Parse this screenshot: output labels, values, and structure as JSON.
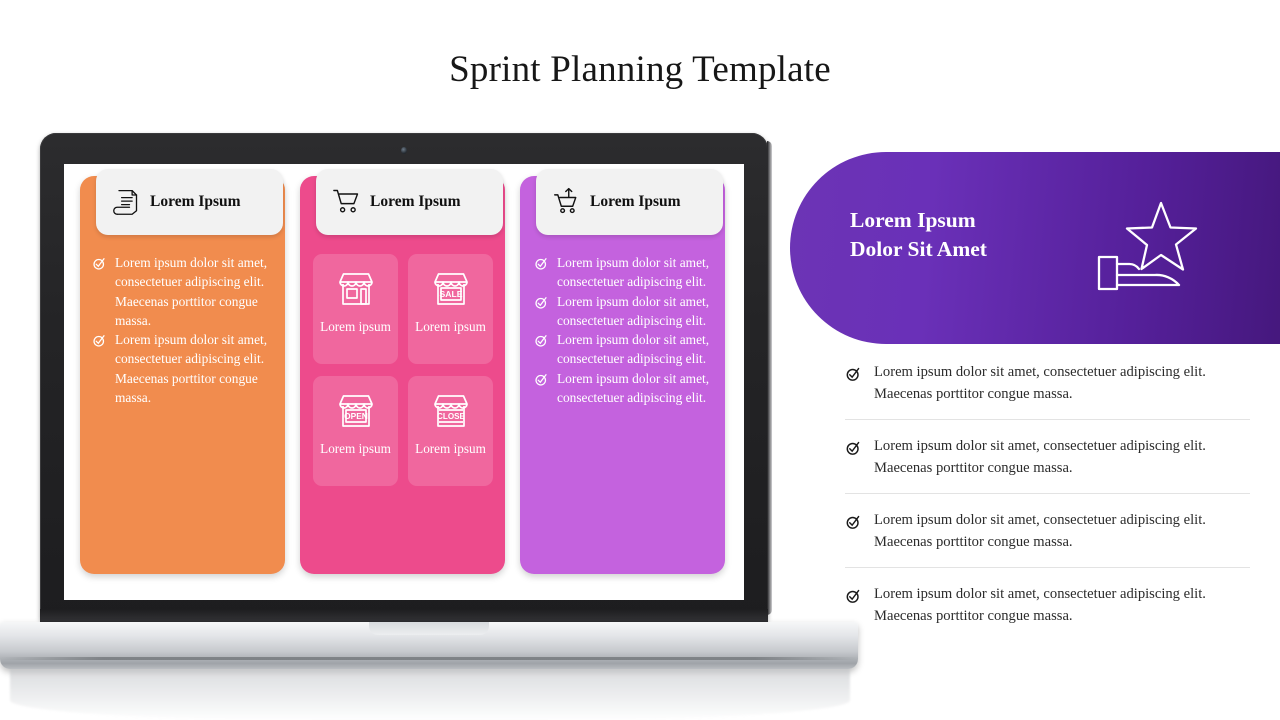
{
  "page": {
    "title": "Sprint Planning Template"
  },
  "laptop": {
    "device_name": "laptop-mockup",
    "camera": "webcam-dot"
  },
  "columns": [
    {
      "id": "orange",
      "color": "#F18C4E",
      "icon": "scroll-document-icon",
      "header": "Lorem Ipsum",
      "bullets": [
        "Lorem ipsum dolor sit amet, consectetuer adipiscing elit. Maecenas porttitor congue massa.",
        "Lorem ipsum dolor sit amet, consectetuer adipiscing elit. Maecenas porttitor congue massa."
      ]
    },
    {
      "id": "pink",
      "color": "#ED4B8C",
      "icon": "shopping-cart-icon",
      "header": "Lorem Ipsum",
      "tiles": [
        {
          "icon": "store-front-icon",
          "label": "Lorem ipsum"
        },
        {
          "icon": "store-sale-icon",
          "label": "Lorem ipsum"
        },
        {
          "icon": "store-open-icon",
          "label": "Lorem ipsum"
        },
        {
          "icon": "store-close-icon",
          "label": "Lorem ipsum"
        }
      ]
    },
    {
      "id": "purple",
      "color": "#C462DE",
      "icon": "cart-upload-icon",
      "header": "Lorem Ipsum",
      "bullets": [
        "Lorem ipsum dolor sit amet, consectetuer adipiscing elit.",
        "Lorem ipsum dolor sit amet, consectetuer adipiscing elit.",
        "Lorem ipsum dolor sit amet, consectetuer adipiscing elit.",
        "Lorem ipsum dolor sit amet, consectetuer adipiscing elit."
      ]
    }
  ],
  "arrows": [
    {
      "name": "arrow-right-orange",
      "color": "#F18C4E"
    },
    {
      "name": "arrow-right-pink",
      "color": "#ED4B8C"
    }
  ],
  "banner": {
    "title_line1": "Lorem Ipsum",
    "title_line2": "Dolor Sit Amet",
    "icon": "hand-star-award-icon",
    "gradient_from": "#6C34B5",
    "gradient_to": "#3E1470"
  },
  "right_list": [
    "Lorem ipsum dolor sit amet, consectetuer adipiscing elit. Maecenas porttitor congue massa.",
    "Lorem ipsum dolor sit amet, consectetuer adipiscing elit. Maecenas porttitor congue massa.",
    "Lorem ipsum dolor sit amet, consectetuer adipiscing elit. Maecenas porttitor congue massa.",
    "Lorem ipsum dolor sit amet, consectetuer adipiscing elit. Maecenas porttitor congue massa."
  ]
}
